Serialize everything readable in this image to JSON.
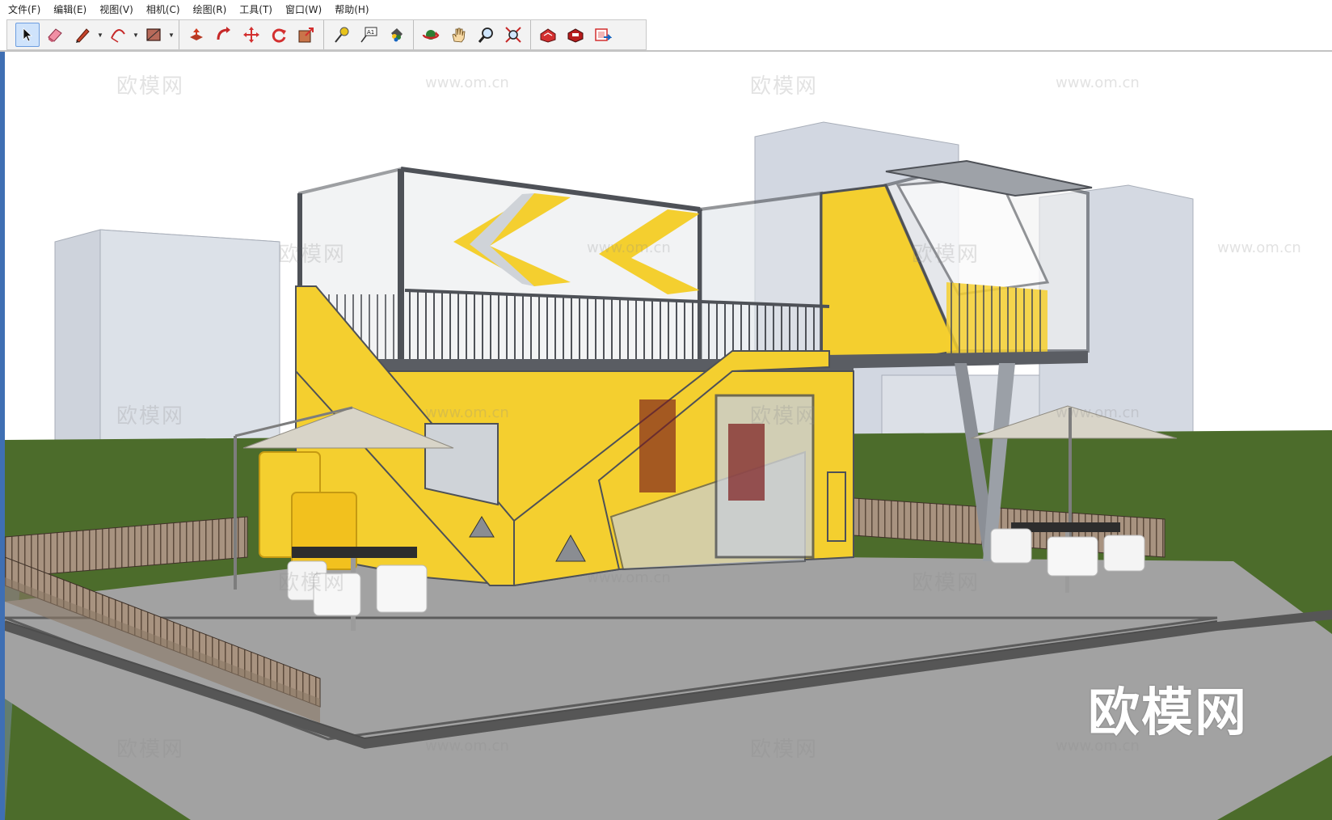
{
  "menu": {
    "items": [
      "文件(F)",
      "编辑(E)",
      "视图(V)",
      "相机(C)",
      "绘图(R)",
      "工具(T)",
      "窗口(W)",
      "帮助(H)"
    ]
  },
  "toolbar": {
    "tools": [
      "select-icon",
      "eraser-icon",
      "pencil-icon",
      "arc-icon",
      "rectangle-icon",
      "push-pull-icon",
      "follow-me-icon",
      "move-icon",
      "rotate-icon",
      "scale-icon",
      "tape-measure-icon",
      "text-icon",
      "paint-bucket-icon",
      "orbit-icon",
      "pan-icon",
      "zoom-icon",
      "zoom-extents-icon",
      "warehouse-icon",
      "extension-warehouse-icon",
      "send-to-layout-icon"
    ],
    "text_tool_label": "A1"
  },
  "watermarks": {
    "brand": "欧模网",
    "url": "www.om.cn",
    "large_logo": "欧模网"
  },
  "colors": {
    "sky": "#ffffff",
    "grass": "#4b6b2a",
    "pavement": "#9c9c9c",
    "container_yellow": "#f4cf2f",
    "steel": "#5a5d63",
    "building_glass": "#c9d2df"
  }
}
